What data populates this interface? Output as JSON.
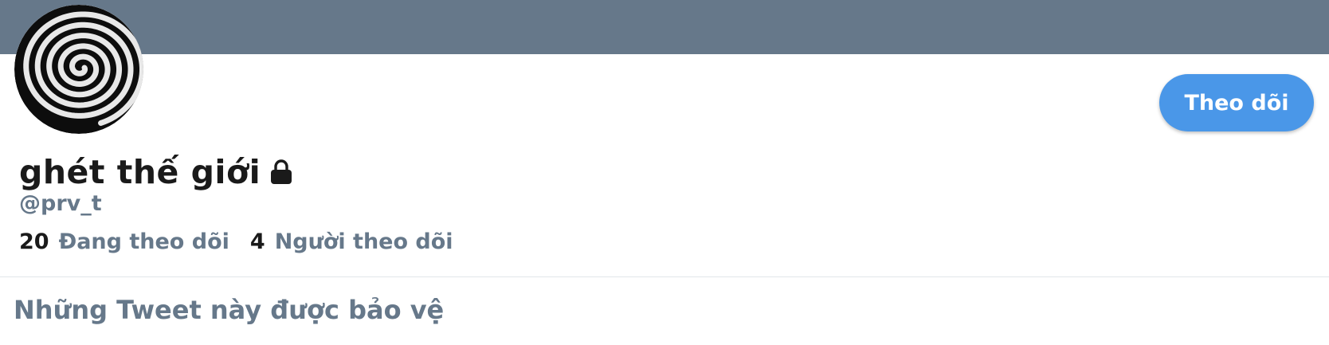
{
  "colors": {
    "banner": "#66788a",
    "accent": "#4a97e8",
    "secondary_text": "#66788a",
    "primary_text": "#1a1a1a"
  },
  "profile": {
    "avatar_icon": "spiral-avatar",
    "display_name": "ghét thế giới",
    "protected_icon": "lock-icon",
    "handle": "@prv_t",
    "follow_button_label": "Theo dõi",
    "following_count": "20",
    "following_label": "Đang theo dõi",
    "followers_count": "4",
    "followers_label": "Người theo dõi"
  },
  "protected_notice": {
    "title": "Những Tweet này được bảo vệ"
  }
}
